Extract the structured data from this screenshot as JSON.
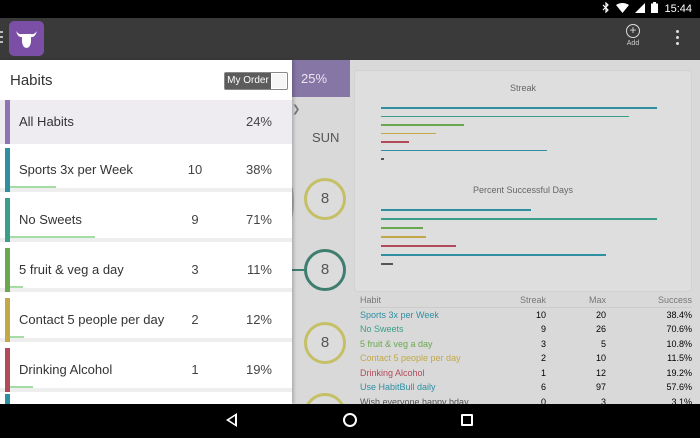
{
  "status_bar": {
    "time": "15:44"
  },
  "app_bar": {
    "add_label": "Add"
  },
  "drawer": {
    "title": "Habits",
    "order_toggle_label": "My Order",
    "all_habits": {
      "name": "All Habits",
      "percent": "24%",
      "color": "#8e74b3"
    },
    "habits": [
      {
        "name": "Sports 3x per Week",
        "streak": "10",
        "percent": "38%",
        "color": "#2e8fa3",
        "progress": 0.38
      },
      {
        "name": "No Sweets",
        "streak": "9",
        "percent": "71%",
        "color": "#3a9e8a",
        "progress": 0.71
      },
      {
        "name": "5 fruit & veg a day",
        "streak": "3",
        "percent": "11%",
        "color": "#6aa84f",
        "progress": 0.11
      },
      {
        "name": "Contact 5 people per day",
        "streak": "2",
        "percent": "12%",
        "color": "#c2a847",
        "progress": 0.12
      },
      {
        "name": "Drinking Alcohol",
        "streak": "1",
        "percent": "19%",
        "color": "#b34a5a",
        "progress": 0.19
      }
    ]
  },
  "background": {
    "overall_percent": "25%",
    "day": "SUN",
    "day_values": [
      "8",
      "8",
      "8"
    ],
    "streak_chart_title": "Streak",
    "success_chart_title": "Percent Successful Days",
    "streak_bars": [
      {
        "value": 10,
        "color": "#2e8fa3"
      },
      {
        "value": 9,
        "color": "#3a9e8a"
      },
      {
        "value": 3,
        "color": "#6aa84f"
      },
      {
        "value": 2,
        "color": "#c2a847"
      },
      {
        "value": 1,
        "color": "#b34a5a"
      },
      {
        "value": 6,
        "color": "#2e8fa3"
      },
      {
        "value": 0,
        "color": "#555555"
      }
    ],
    "success_bars": [
      {
        "value": 38.4,
        "color": "#2e8fa3"
      },
      {
        "value": 70.6,
        "color": "#3a9e8a"
      },
      {
        "value": 10.8,
        "color": "#6aa84f"
      },
      {
        "value": 11.5,
        "color": "#c2a847"
      },
      {
        "value": 19.2,
        "color": "#b34a5a"
      },
      {
        "value": 57.6,
        "color": "#2e8fa3"
      },
      {
        "value": 3.1,
        "color": "#555555"
      }
    ],
    "table": {
      "headers": {
        "habit": "Habit",
        "streak": "Streak",
        "max": "Max",
        "success": "Success"
      },
      "rows": [
        {
          "habit": "Sports 3x per Week",
          "streak": "10",
          "max": "20",
          "success": "38.4%",
          "color": "#2e8fa3"
        },
        {
          "habit": "No Sweets",
          "streak": "9",
          "max": "26",
          "success": "70.6%",
          "color": "#3a9e8a"
        },
        {
          "habit": "5 fruit & veg a day",
          "streak": "3",
          "max": "5",
          "success": "10.8%",
          "color": "#6aa84f"
        },
        {
          "habit": "Contact 5 people per day",
          "streak": "2",
          "max": "10",
          "success": "11.5%",
          "color": "#c2a847"
        },
        {
          "habit": "Drinking Alcohol",
          "streak": "1",
          "max": "12",
          "success": "19.2%",
          "color": "#b34a5a"
        },
        {
          "habit": "Use HabitBull daily",
          "streak": "6",
          "max": "97",
          "success": "57.6%",
          "color": "#2e8fa3"
        },
        {
          "habit": "Wish everyone happy bday",
          "streak": "0",
          "max": "3",
          "success": "3.1%",
          "color": "#555555"
        }
      ]
    }
  },
  "icons": {
    "bluetooth": "bluetooth-icon",
    "wifi": "wifi-icon",
    "signal": "signal-icon",
    "battery": "battery-icon",
    "logo": "bull-logo-icon",
    "add": "add-circle-icon",
    "overflow": "overflow-menu-icon"
  }
}
